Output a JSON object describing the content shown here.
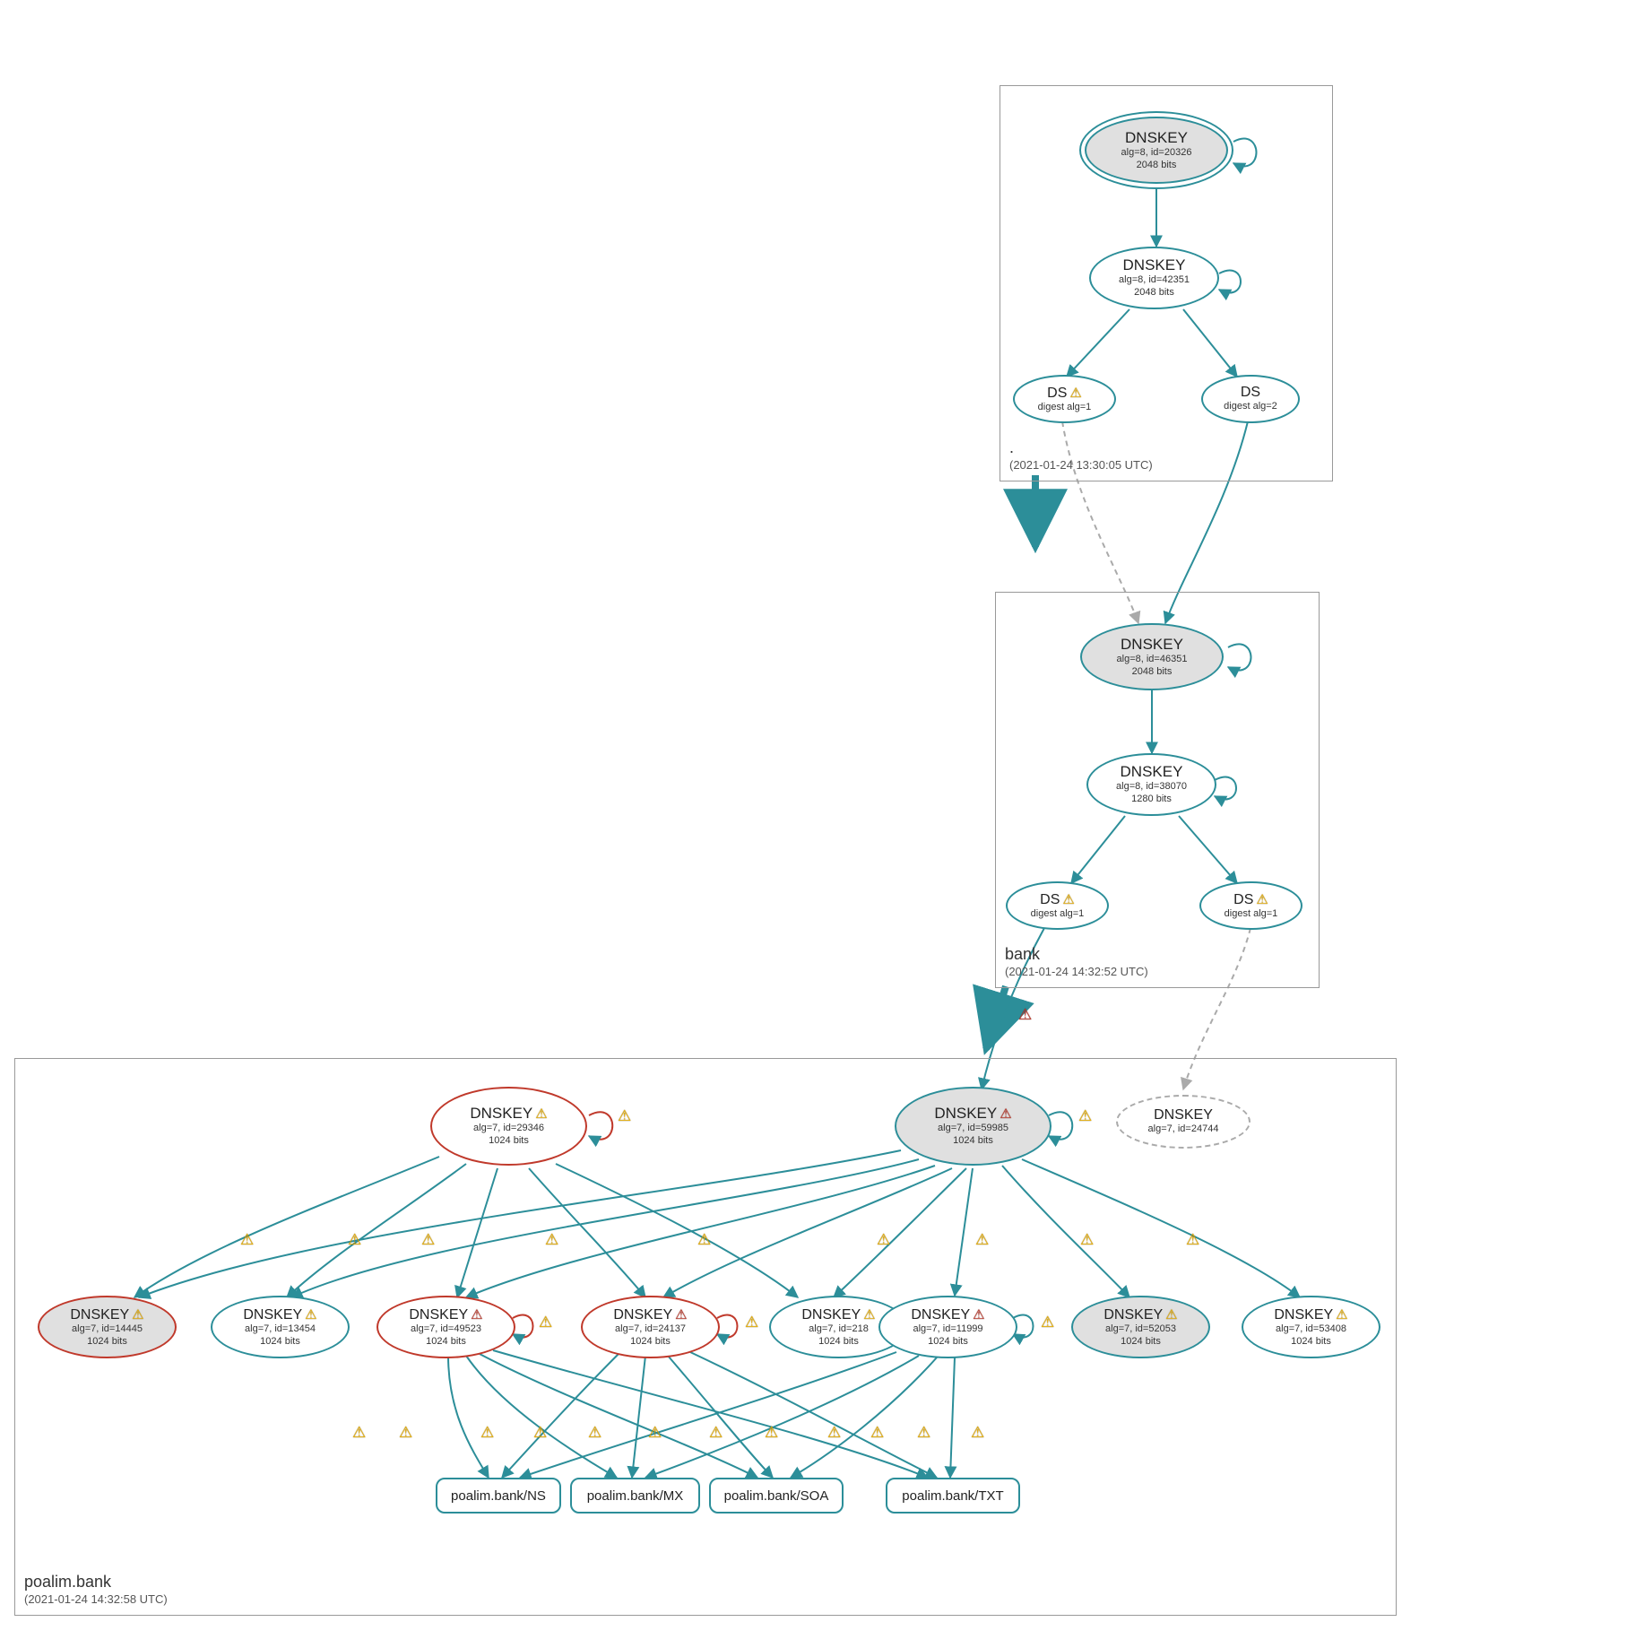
{
  "zones": {
    "root": {
      "name": ".",
      "timestamp": "(2021-01-24 13:30:05 UTC)"
    },
    "bank": {
      "name": "bank",
      "timestamp": "(2021-01-24 14:32:52 UTC)"
    },
    "poalim": {
      "name": "poalim.bank",
      "timestamp": "(2021-01-24 14:32:58 UTC)"
    }
  },
  "nodes": {
    "root_ksk": {
      "title": "DNSKEY",
      "meta": "alg=8, id=20326",
      "bits": "2048 bits"
    },
    "root_zsk": {
      "title": "DNSKEY",
      "meta": "alg=8, id=42351",
      "bits": "2048 bits"
    },
    "root_ds1": {
      "title": "DS",
      "meta": "digest alg=1"
    },
    "root_ds2": {
      "title": "DS",
      "meta": "digest alg=2"
    },
    "bank_ksk": {
      "title": "DNSKEY",
      "meta": "alg=8, id=46351",
      "bits": "2048 bits"
    },
    "bank_zsk": {
      "title": "DNSKEY",
      "meta": "alg=8, id=38070",
      "bits": "1280 bits"
    },
    "bank_ds1": {
      "title": "DS",
      "meta": "digest alg=1"
    },
    "bank_ds2": {
      "title": "DS",
      "meta": "digest alg=1"
    },
    "p_ksk_a": {
      "title": "DNSKEY",
      "meta": "alg=7, id=29346",
      "bits": "1024 bits"
    },
    "p_ksk_b": {
      "title": "DNSKEY",
      "meta": "alg=7, id=59985",
      "bits": "1024 bits"
    },
    "p_stub": {
      "title": "DNSKEY",
      "meta": "alg=7, id=24744"
    },
    "p_r1": {
      "title": "DNSKEY",
      "meta": "alg=7, id=14445",
      "bits": "1024 bits"
    },
    "p_r2": {
      "title": "DNSKEY",
      "meta": "alg=7, id=13454",
      "bits": "1024 bits"
    },
    "p_r3": {
      "title": "DNSKEY",
      "meta": "alg=7, id=49523",
      "bits": "1024 bits"
    },
    "p_r4": {
      "title": "DNSKEY",
      "meta": "alg=7, id=24137",
      "bits": "1024 bits"
    },
    "p_r5": {
      "title": "DNSKEY",
      "meta": "alg=7, id=218",
      "bits": "1024 bits"
    },
    "p_r6": {
      "title": "DNSKEY",
      "meta": "alg=7, id=11999",
      "bits": "1024 bits"
    },
    "p_r7": {
      "title": "DNSKEY",
      "meta": "alg=7, id=52053",
      "bits": "1024 bits"
    },
    "p_r8": {
      "title": "DNSKEY",
      "meta": "alg=7, id=53408",
      "bits": "1024 bits"
    }
  },
  "leaves": {
    "ns": "poalim.bank/NS",
    "mx": "poalim.bank/MX",
    "soa": "poalim.bank/SOA",
    "txt": "poalim.bank/TXT"
  }
}
